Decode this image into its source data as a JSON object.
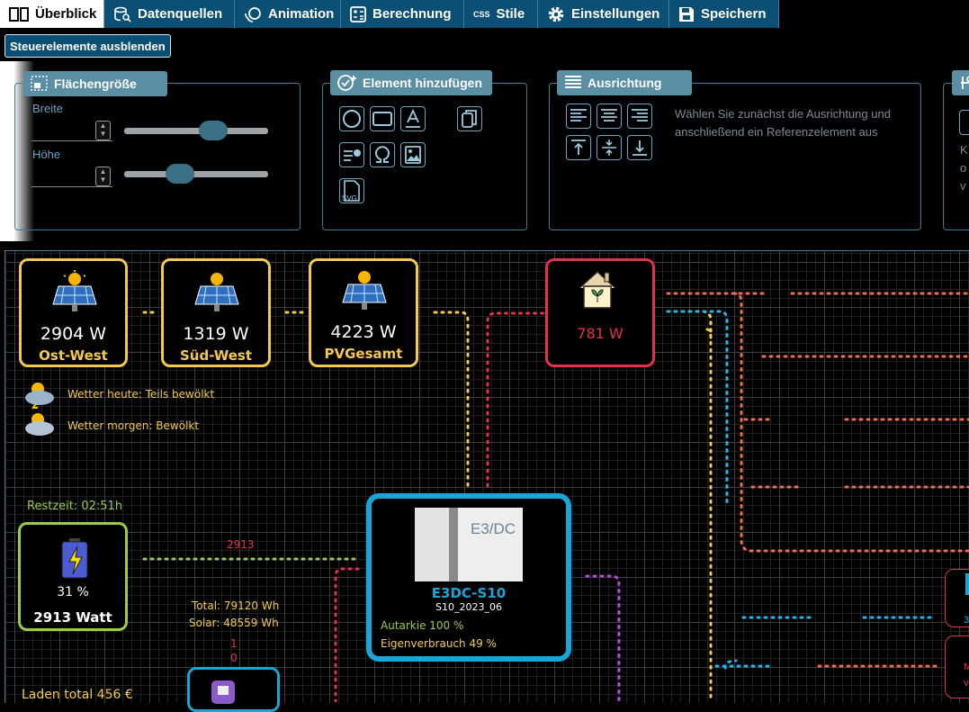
{
  "tabs": [
    {
      "label": "Überblick",
      "icon": "columns-icon"
    },
    {
      "label": "Datenquellen",
      "icon": "database-search-icon"
    },
    {
      "label": "Animation",
      "icon": "animation-icon"
    },
    {
      "label": "Berechnung",
      "icon": "calculator-icon"
    },
    {
      "label": "Stile",
      "icon": "css-icon",
      "icon_text": "CSS"
    },
    {
      "label": "Einstellungen",
      "icon": "gear-icon"
    },
    {
      "label": "Speichern",
      "icon": "save-icon"
    }
  ],
  "toggle_controls_label": "Steuerelemente ausblenden",
  "panels": {
    "size": {
      "title": "Flächengröße",
      "width_label": "Breite",
      "height_label": "Höhe",
      "width_slider": 0.62,
      "height_slider": 0.39
    },
    "add": {
      "title": "Element hinzufügen",
      "buttons": [
        "circle",
        "rectangle",
        "text",
        "copy",
        "list-check",
        "omega",
        "image",
        "svg"
      ],
      "svg_label": "SVG"
    },
    "align": {
      "title": "Ausrichtung",
      "hint_line1": "Wählen Sie zunächst die Ausrichtung und",
      "hint_line2": "anschließend ein Referenzelement aus"
    },
    "fourth": {
      "partial_text": [
        "K",
        "o",
        "v"
      ]
    }
  },
  "canvas": {
    "pv": [
      {
        "value": "2904 W",
        "name": "Ost-West"
      },
      {
        "value": "1319 W",
        "name": "Süd-West"
      },
      {
        "value": "4223 W",
        "name": "PVGesamt"
      }
    ],
    "house": {
      "value": "781 W"
    },
    "weather_today": "Wetter heute: Teils bewölkt",
    "weather_tomorrow": "Wetter morgen: Bewölkt",
    "battery": {
      "remaining": "Restzeit: 02:51h",
      "percent": "31 %",
      "watt": "2913 Watt",
      "flow": "2913"
    },
    "totals": {
      "total": "Total: 79120 Wh",
      "solar": "Solar: 48559 Wh"
    },
    "counter_a": "1",
    "counter_b": "0",
    "charge_total": "Laden total 456 €",
    "device": {
      "name": "E3DC-S10",
      "model": "S10_2023_06",
      "logo": "E3/DC",
      "autarky": "Autarkie 100 %",
      "self_consumption": "Eigenverbrauch 49 %"
    },
    "right_partial": [
      "3",
      "M",
      "v"
    ]
  },
  "colors": {
    "tab_bg": "#0c4f74",
    "panel_title": "#5a8ea3",
    "pv_border": "#f2c94c",
    "house_border": "#e0324a",
    "battery_border": "#9ccc45",
    "device_border": "#19a6d6"
  }
}
